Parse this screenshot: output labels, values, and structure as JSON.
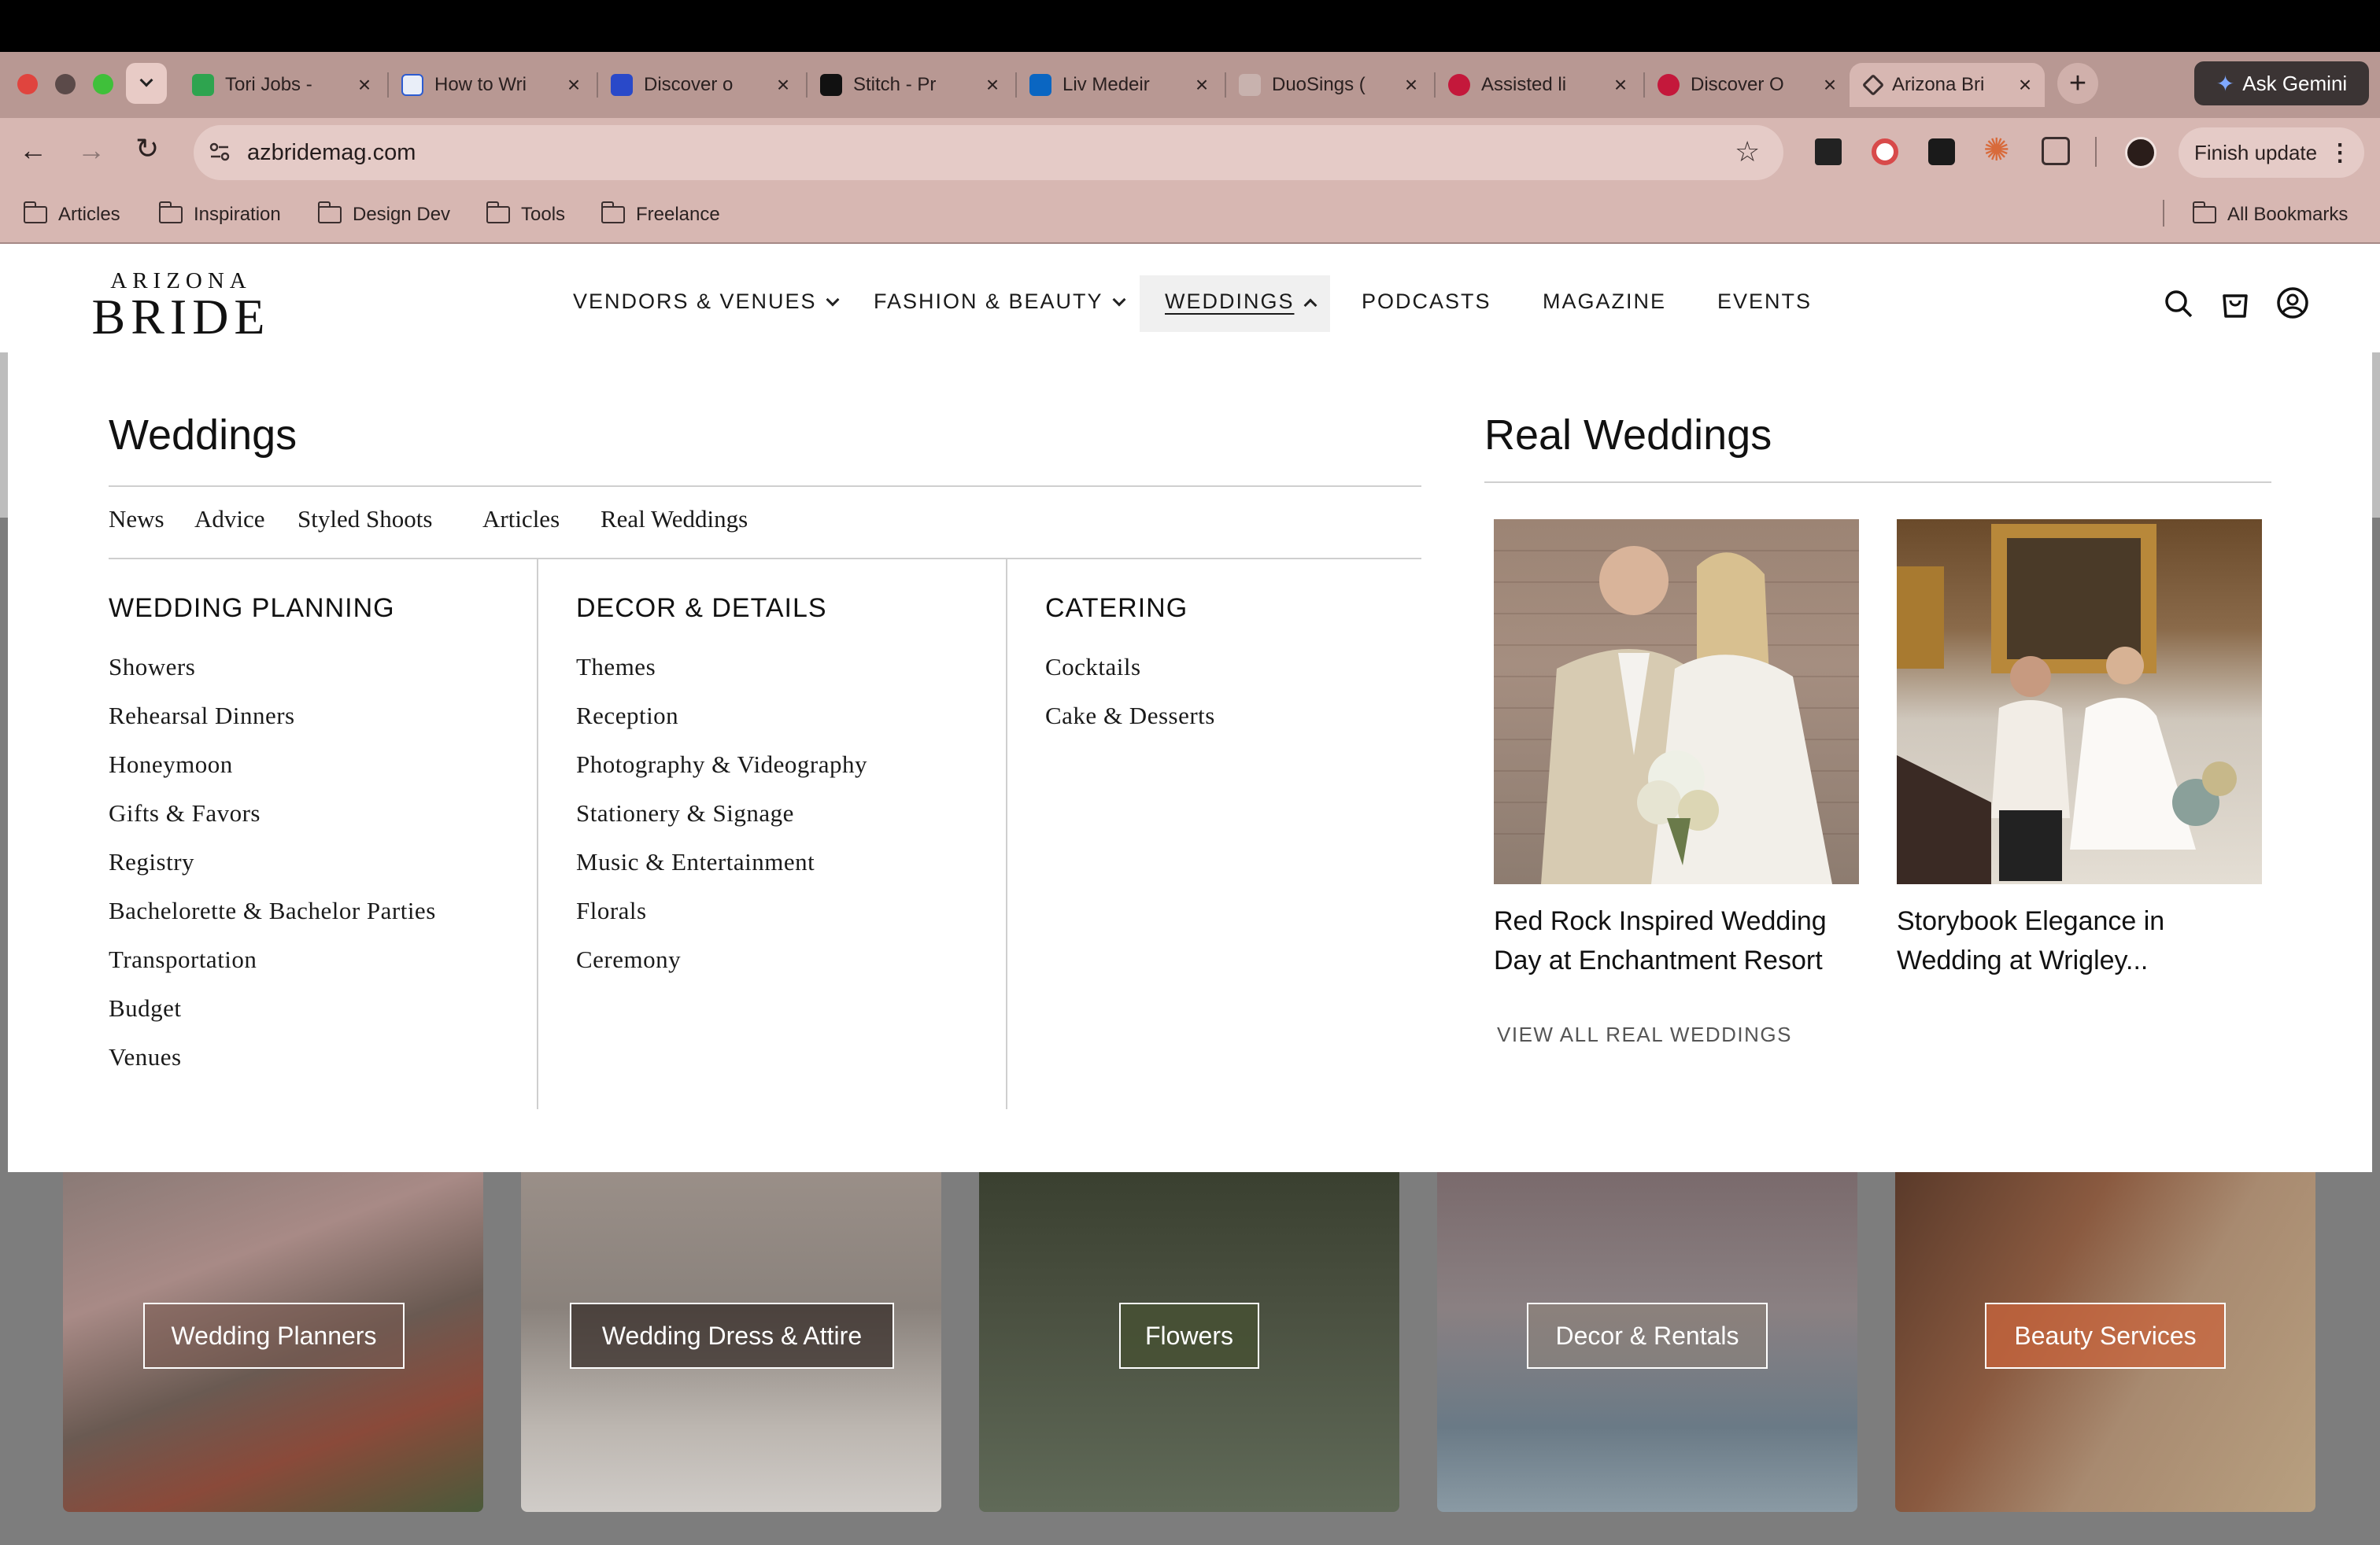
{
  "browser": {
    "tabs": [
      {
        "title": "Tori Jobs -",
        "active": false
      },
      {
        "title": "How to Wri",
        "active": false
      },
      {
        "title": "Discover o",
        "active": false
      },
      {
        "title": "Stitch - Pr",
        "active": false
      },
      {
        "title": "Liv Medeir",
        "active": false
      },
      {
        "title": "DuoSings (",
        "active": false
      },
      {
        "title": "Assisted li",
        "active": false
      },
      {
        "title": "Discover O",
        "active": false
      },
      {
        "title": "Arizona Bri",
        "active": true
      }
    ],
    "ask_gemini": "Ask Gemini",
    "url": "azbridemag.com",
    "finish_update": "Finish update",
    "bookmarks": [
      "Articles",
      "Inspiration",
      "Design Dev",
      "Tools",
      "Freelance"
    ],
    "all_bookmarks": "All Bookmarks"
  },
  "site": {
    "logo_top": "ARIZONA",
    "logo_bottom": "BRIDE",
    "nav": [
      "VENDORS & VENUES",
      "FASHION & BEAUTY",
      "WEDDINGS",
      "PODCASTS",
      "MAGAZINE",
      "EVENTS"
    ]
  },
  "mega": {
    "title": "Weddings",
    "quick_links": [
      "News",
      "Advice",
      "Styled Shoots",
      "Articles",
      "Real Weddings"
    ],
    "columns": [
      {
        "heading": "WEDDING PLANNING",
        "links": [
          "Showers",
          "Rehearsal Dinners",
          "Honeymoon",
          "Gifts & Favors",
          "Registry",
          "Bachelorette & Bachelor Parties",
          "Transportation",
          "Budget",
          "Venues"
        ]
      },
      {
        "heading": "DECOR & DETAILS",
        "links": [
          "Themes",
          "Reception",
          "Photography & Videography",
          "Stationery & Signage",
          "Music & Entertainment",
          "Florals",
          "Ceremony"
        ]
      },
      {
        "heading": "CATERING",
        "links": [
          "Cocktails",
          "Cake & Desserts"
        ]
      }
    ],
    "real_weddings_title": "Real Weddings",
    "features": [
      {
        "line1": "Red Rock Inspired Wedding",
        "line2": "Day at Enchantment Resort"
      },
      {
        "line1": "Storybook Elegance in",
        "line2": "Wedding at Wrigley..."
      }
    ],
    "view_all": "VIEW ALL REAL WEDDINGS"
  },
  "categories": [
    "Wedding Planners",
    "Wedding Dress & Attire",
    "Flowers",
    "Decor & Rentals",
    "Beauty Services"
  ]
}
